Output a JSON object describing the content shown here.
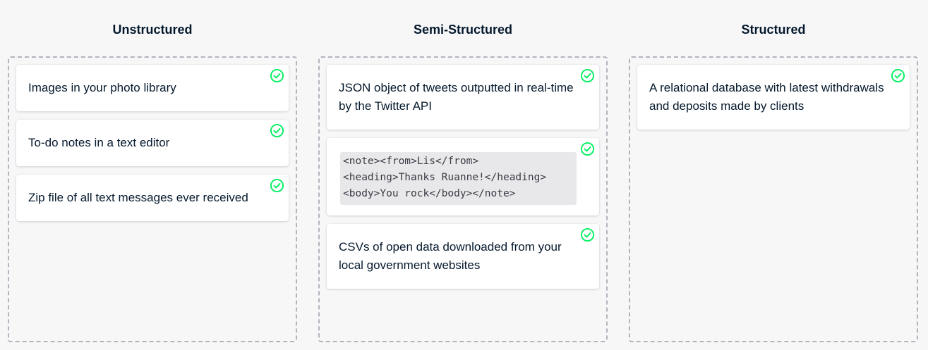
{
  "columns": [
    {
      "title": "Unstructured",
      "cards": [
        {
          "text": "Images in your photo library"
        },
        {
          "text": "To-do notes in a text editor"
        },
        {
          "text": "Zip file of all text messages ever received"
        }
      ]
    },
    {
      "title": "Semi-Structured",
      "cards": [
        {
          "text": "JSON object of tweets outputted in real-time by the Twitter API"
        },
        {
          "code_lines": [
            "<note><from>Lis</from>",
            "<heading>Thanks Ruanne!</heading>",
            "<body>You rock</body></note>"
          ]
        },
        {
          "text": "CSVs of open data downloaded from your local government websites"
        }
      ]
    },
    {
      "title": "Structured",
      "cards": [
        {
          "text": "A relational database with latest withdrawals and deposits made by clients"
        }
      ]
    }
  ],
  "icons": {
    "card_status": "check-circle-icon"
  },
  "colors": {
    "check": "#03ef62",
    "text": "#05192d",
    "dropzone_border": "#b3b4bd",
    "code_bg": "#e8e8ea"
  }
}
